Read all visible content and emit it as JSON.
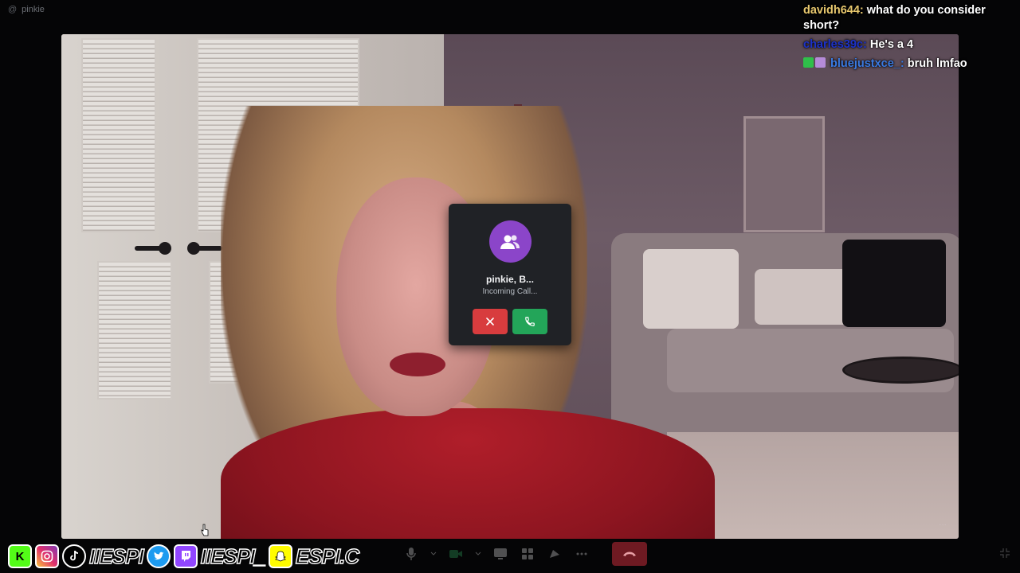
{
  "channel": {
    "name": "pinkie",
    "prefix": "@"
  },
  "call": {
    "caller_name": "pinkie, B...",
    "status": "Incoming Call...",
    "avatar_icon": "group-icon",
    "decline_icon": "close-icon",
    "accept_icon": "phone-icon",
    "colors": {
      "avatar": "#8b45c9",
      "decline": "#d83c3e",
      "accept": "#23a559",
      "card": "#202226"
    }
  },
  "chat": {
    "messages": [
      {
        "user": "davidh644:",
        "text": "what do you consider short?",
        "color": "#e8c86e"
      },
      {
        "user": "charles39c:",
        "text": "He's a 4",
        "color": "#1c32c9"
      },
      {
        "user": "bluejustxce_:",
        "text": "bruh lmfao",
        "color": "#3a7ae0",
        "badges": [
          "checkmark-badge",
          "calendar-badge"
        ]
      }
    ]
  },
  "controls": {
    "items": [
      "microphone-icon",
      "chevron-down-icon",
      "camera-icon",
      "chevron-down-icon",
      "screenshare-icon",
      "activities-icon",
      "soundboard-icon",
      "more-icon"
    ],
    "end_call": "hangup-icon"
  },
  "socials": {
    "handle1": "IIESPI",
    "handle2": "IIESPI_",
    "handle3": "ESPI.C",
    "icons": [
      "kick-icon",
      "instagram-icon",
      "tiktok-icon",
      "twitter-icon",
      "twitch-icon",
      "snapchat-icon"
    ]
  }
}
